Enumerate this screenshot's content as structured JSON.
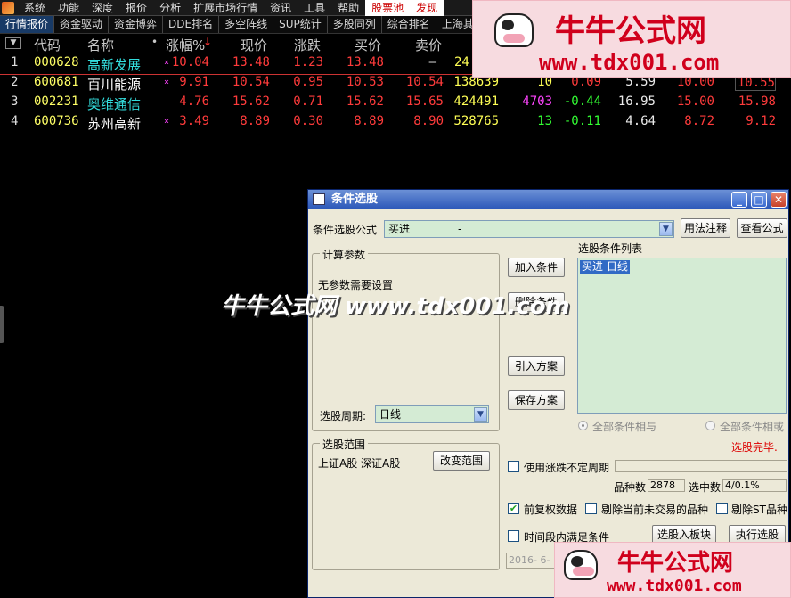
{
  "menubar": {
    "items": [
      "系统",
      "功能",
      "深度",
      "报价",
      "分析",
      "扩展市场行情",
      "资讯",
      "工具",
      "帮助",
      "股票池",
      "发现"
    ],
    "active_index": 9
  },
  "tabs": {
    "items": [
      "行情报价",
      "资金驱动",
      "资金博弈",
      "DDE排名",
      "多空阵线",
      "SUP统计",
      "多股同列",
      "综合排名",
      "上海其"
    ],
    "active_index": 0
  },
  "quote_table": {
    "headers": {
      "sel": "▼",
      "code": "代码",
      "name": "名称",
      "dot": "•",
      "pct": "涨幅%",
      "price": "现价",
      "change": "涨跌",
      "bid": "买价",
      "ask": "卖价"
    },
    "rows": [
      {
        "idx": "1",
        "code": "000628",
        "name": "高新发展",
        "mark": "×",
        "pct": "10.04",
        "price": "13.48",
        "change": "1.23",
        "bid": "13.48",
        "ask": "–",
        "vol": "24",
        "c10": "",
        "c11": "",
        "c12": "",
        "c13": "",
        "c14": ""
      },
      {
        "idx": "2",
        "code": "600681",
        "name": "百川能源",
        "mark": "×",
        "pct": "9.91",
        "price": "10.54",
        "change": "0.95",
        "bid": "10.53",
        "ask": "10.54",
        "vol": "138639",
        "c10": "10",
        "c11": "0.09",
        "c12": "5.59",
        "c13": "10.00",
        "c14": "10.55"
      },
      {
        "idx": "3",
        "code": "002231",
        "name": "奥维通信",
        "mark": "",
        "pct": "4.76",
        "price": "15.62",
        "change": "0.71",
        "bid": "15.62",
        "ask": "15.65",
        "vol": "424491",
        "c10": "4703",
        "c11": "-0.44",
        "c12": "16.95",
        "c13": "15.00",
        "c14": "15.98"
      },
      {
        "idx": "4",
        "code": "600736",
        "name": "苏州高新",
        "mark": "×",
        "pct": "3.49",
        "price": "8.89",
        "change": "0.30",
        "bid": "8.89",
        "ask": "8.90",
        "vol": "528765",
        "c10": "13",
        "c11": "-0.11",
        "c12": "4.64",
        "c13": "8.72",
        "c14": "9.12"
      }
    ]
  },
  "dialog": {
    "title": "条件选股",
    "formula_label": "条件选股公式",
    "formula_value": "买进",
    "formula_dash": "-",
    "usage_btn": "用法注释",
    "view_formula_btn": "查看公式",
    "params_group": "计算参数",
    "no_params": "无参数需要设置",
    "period_label": "选股周期:",
    "period_value": "日线",
    "add_cond_btn": "加入条件",
    "del_cond_btn": "删除条件",
    "import_btn": "引入方案",
    "save_btn": "保存方案",
    "cond_list_label": "选股条件列表",
    "cond_item": "买进  日线",
    "radio_and": "全部条件相与",
    "radio_or": "全部条件相或",
    "status": "选股完毕.",
    "range_group": "选股范围",
    "range_value": "上证A股 深证A股",
    "change_range_btn": "改变范围",
    "use_period_label": "使用涨跌不定周期",
    "count_label": "品种数",
    "count_value": "2878",
    "selected_label": "选中数",
    "selected_value": "4/0.1%",
    "fq_label": "前复权数据",
    "exclude_halt_label": "剔除当前未交易的品种",
    "exclude_st_label": "剔除ST品种",
    "time_range_label": "时间段内满足条件",
    "to_block_btn": "选股入板块",
    "exec_btn": "执行选股",
    "date_value": "2016- 6-"
  },
  "watermark": {
    "brand": "牛牛公式网",
    "url": "www.tdx001.com",
    "mid_text": "牛牛公式网 www.tdx001.com"
  },
  "colors": {
    "code": "#ffff66",
    "name_red": "#ff5050",
    "name_cyan": "#33dddd",
    "name_white": "#ffffff",
    "up": "#ff3b3b",
    "down": "#33ff33",
    "vol": "#ffff55",
    "magenta": "#ff44ff",
    "white": "#eaeaea"
  }
}
